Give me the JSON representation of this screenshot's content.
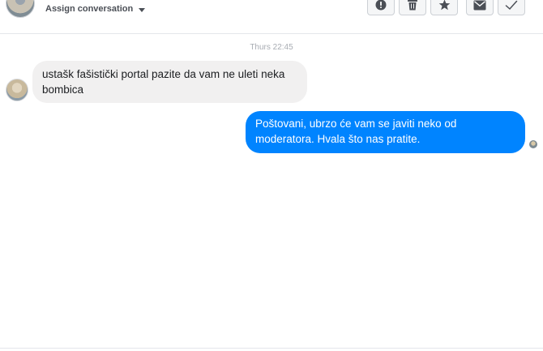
{
  "header": {
    "assign_label": "Assign conversation",
    "actions": [
      {
        "name": "report-button",
        "icon": "exclamation-circle-icon"
      },
      {
        "name": "delete-button",
        "icon": "trash-icon"
      },
      {
        "name": "star-button",
        "icon": "star-icon"
      },
      {
        "name": "mark-unread-button",
        "icon": "envelope-icon"
      },
      {
        "name": "mark-done-button",
        "icon": "checkmark-icon"
      }
    ]
  },
  "conversation": {
    "timestamp": "Thurs 22:45",
    "messages": [
      {
        "direction": "incoming",
        "text": "ustašk fašistički portal pazite da vam ne uleti neka bombica"
      },
      {
        "direction": "outgoing",
        "text": "Poštovani, ubrzo će vam se javiti neko od moderatora. Hvala što nas pratite."
      }
    ]
  },
  "colors": {
    "outgoing_bubble": "#0084ff",
    "incoming_bubble": "#f1f0f0",
    "timestamp": "#a8acb3"
  }
}
